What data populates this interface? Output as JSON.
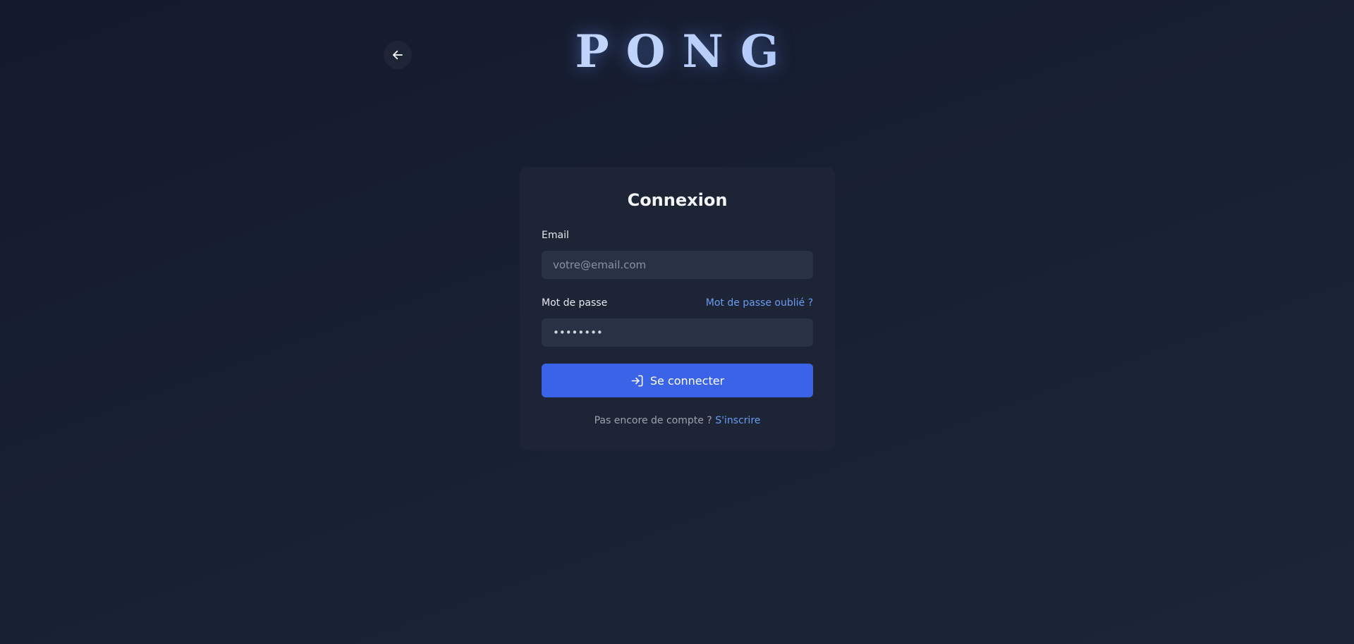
{
  "header": {
    "logo_text": "PONG",
    "back_icon": "arrow-left-icon"
  },
  "login": {
    "title": "Connexion",
    "email_label": "Email",
    "email_placeholder": "votre@email.com",
    "password_label": "Mot de passe",
    "password_value": "password",
    "forgot_link": "Mot de passe oublié ?",
    "submit_label": "Se connecter",
    "submit_icon": "login-icon",
    "no_account_text": "Pas encore de compte ?",
    "signup_link": "S'inscrire"
  },
  "colors": {
    "background": "#161d30",
    "card": "#1d2436",
    "input": "#283244",
    "primary": "#3b63e8",
    "link": "#6b9cf0"
  }
}
